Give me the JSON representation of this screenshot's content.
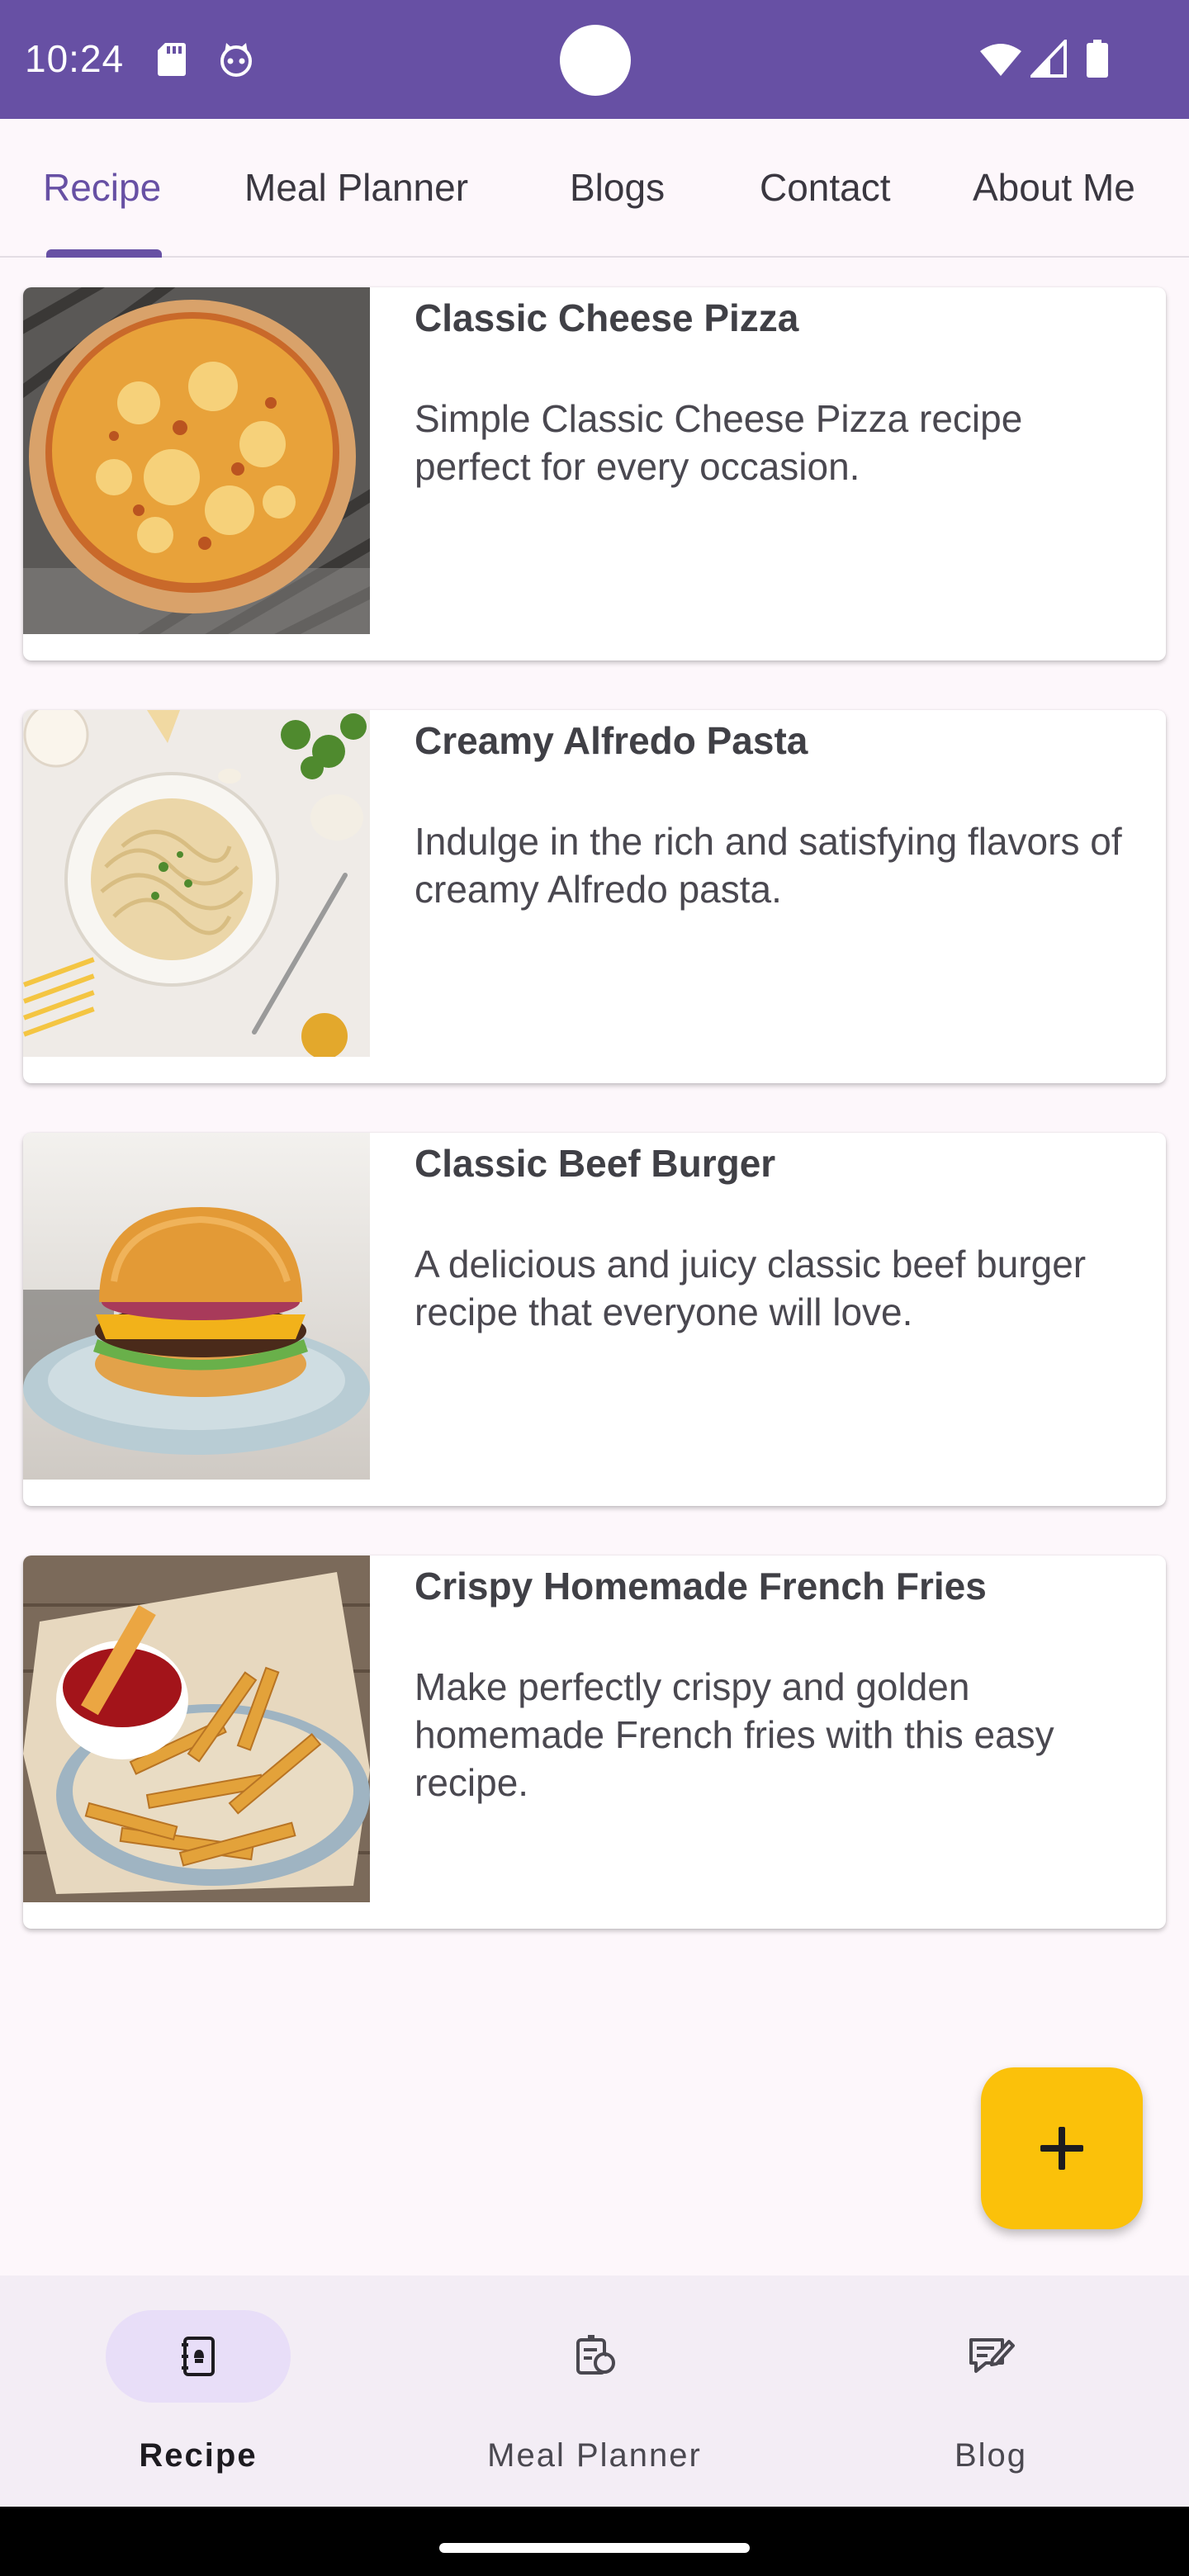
{
  "status_bar": {
    "time": "10:24",
    "icons": [
      "sd-card-icon",
      "cat-face-icon",
      "wifi-icon",
      "cell-signal-icon",
      "battery-icon"
    ],
    "color": "#6750a4"
  },
  "top_tabs": {
    "items": [
      {
        "label": "Recipe",
        "active": true
      },
      {
        "label": "Meal Planner",
        "active": false
      },
      {
        "label": "Blogs",
        "active": false
      },
      {
        "label": "Contact",
        "active": false
      },
      {
        "label": "About Me",
        "active": false
      }
    ]
  },
  "recipes": [
    {
      "title": "Classic Cheese Pizza",
      "description": "Simple Classic Cheese Pizza recipe perfect for every occasion.",
      "image": "pizza-photo"
    },
    {
      "title": "Creamy Alfredo Pasta",
      "description": "Indulge in the rich and satisfying flavors of creamy Alfredo pasta.",
      "image": "pasta-photo"
    },
    {
      "title": "Classic Beef Burger",
      "description": "A delicious and juicy classic beef burger recipe that everyone will love.",
      "image": "burger-photo"
    },
    {
      "title": "Crispy Homemade French Fries",
      "description": "Make perfectly crispy and golden homemade French fries with this easy recipe.",
      "image": "fries-photo"
    }
  ],
  "fab": {
    "icon": "plus-icon",
    "color": "#fbc10a"
  },
  "bottom_nav": {
    "items": [
      {
        "label": "Recipe",
        "icon": "recipe-book-icon",
        "active": true
      },
      {
        "label": "Meal Planner",
        "icon": "meal-planner-icon",
        "active": false
      },
      {
        "label": "Blog",
        "icon": "blog-edit-icon",
        "active": false
      }
    ]
  },
  "colors": {
    "primary": "#6750a4",
    "background": "#fdf7fb",
    "nav_background": "#f3edf5",
    "nav_pill": "#e8def8",
    "accent": "#fbc10a"
  }
}
